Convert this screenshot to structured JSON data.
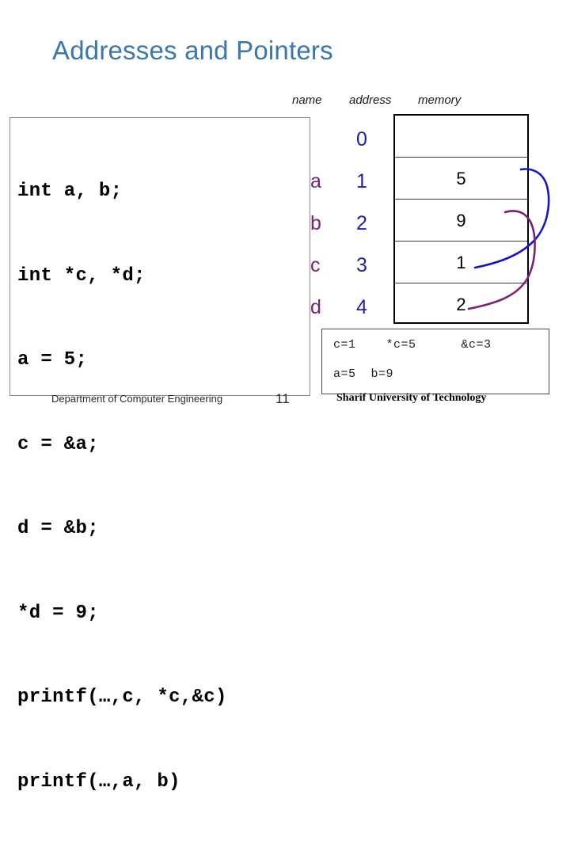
{
  "slide": {
    "title": "Addresses and Pointers"
  },
  "code": {
    "lines": [
      "int a, b;",
      "int *c, *d;",
      "a = 5;",
      "c = &a;",
      "d = &b;",
      "*d = 9;",
      "printf(…,c, *c,&c)",
      "printf(…,a, b)"
    ]
  },
  "diagram": {
    "headers": {
      "name": "name",
      "address": "address",
      "memory": "memory"
    },
    "rows": [
      {
        "name": "",
        "address": "0",
        "memory": ""
      },
      {
        "name": "a",
        "address": "1",
        "memory": "5"
      },
      {
        "name": "b",
        "address": "2",
        "memory": "9"
      },
      {
        "name": "c",
        "address": "3",
        "memory": "1"
      },
      {
        "name": "d",
        "address": "4",
        "memory": "2"
      }
    ],
    "colors": {
      "name_color": "#7A2077",
      "address_color": "#1F1FA8",
      "pointer_c_arrow": "#1515C8",
      "pointer_d_arrow": "#7A2077",
      "title_color": "#3A77AE"
    }
  },
  "output": {
    "line1": "c=1    *c=5      &c=3",
    "line2": "a=5  b=9"
  },
  "footer": {
    "department": "Department of Computer Engineering",
    "page_number": "11",
    "university": "Sharif University of Technology"
  }
}
